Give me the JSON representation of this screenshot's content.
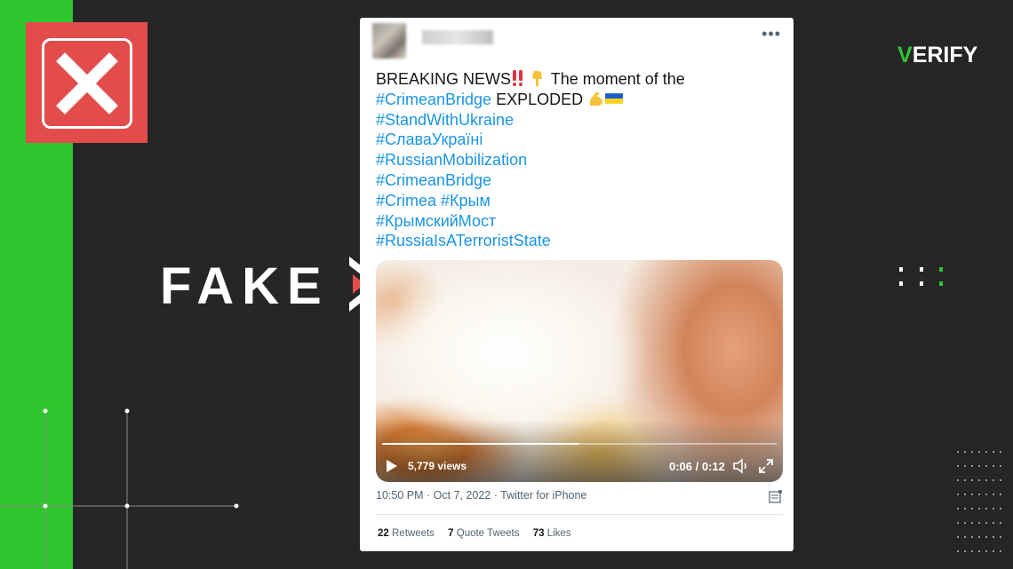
{
  "brand": {
    "logo_check": "V",
    "logo_text": "ERIFY"
  },
  "verdict": {
    "label": "FAKE"
  },
  "tweet": {
    "lines": [
      [
        "BREAKING NEWS",
        "",
        " The moment of the"
      ],
      [
        "#CrimeanBridge",
        " EXPLODED "
      ],
      [
        "#StandWithUkraine"
      ],
      [
        "#СлаваУкраїні"
      ],
      [
        "#RussianMobilization"
      ],
      [
        "#CrimeanBridge"
      ],
      [
        "#Crimea",
        " ",
        "#Крым"
      ],
      [
        "#КрымскийМост"
      ],
      [
        "#RussiaIsATerroristState"
      ]
    ],
    "video": {
      "views": "5,779 views",
      "time": "0:06 / 0:12",
      "progress": 0.5
    },
    "meta": "10:50 PM · Oct 7, 2022 · Twitter for iPhone",
    "stats": {
      "retweets_count": "22",
      "retweets_label": "Retweets",
      "quotes_count": "7",
      "quotes_label": "Quote Tweets",
      "likes_count": "73",
      "likes_label": "Likes"
    }
  },
  "colors": {
    "green": "#2fc52f",
    "red": "#e24c4b",
    "link": "#1b95e0"
  },
  "icons": [
    "close-icon",
    "more-icon",
    "play-icon",
    "volume-icon",
    "fullscreen-icon",
    "analytics-icon",
    "flag-ukraine-icon",
    "flexed-biceps-icon",
    "double-exclamation-icon",
    "pointing-down-icon"
  ]
}
